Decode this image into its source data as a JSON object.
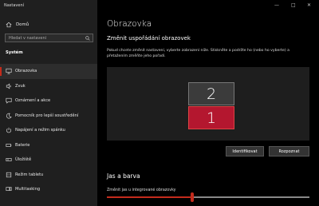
{
  "window": {
    "title": "Nastavení"
  },
  "sidebar": {
    "home_label": "Domů",
    "search_placeholder": "Hledat v nastavení",
    "section_label": "Systém",
    "items": [
      {
        "label": "Obrazovka",
        "icon": "monitor-icon",
        "active": true
      },
      {
        "label": "Zvuk",
        "icon": "speaker-icon"
      },
      {
        "label": "Oznámení a akce",
        "icon": "message-icon"
      },
      {
        "label": "Pomocník pro lepší soustředění",
        "icon": "moon-icon"
      },
      {
        "label": "Napájení a režim spánku",
        "icon": "power-icon"
      },
      {
        "label": "Baterie",
        "icon": "battery-icon"
      },
      {
        "label": "Úložiště",
        "icon": "storage-icon"
      },
      {
        "label": "Režim tabletu",
        "icon": "tablet-icon"
      },
      {
        "label": "Multitasking",
        "icon": "multitasking-icon"
      }
    ]
  },
  "main": {
    "title": "Obrazovka",
    "arrangement_heading": "Změnit uspořádání obrazovek",
    "arrangement_desc": "Pokud chcete změnit nastavení, vyberte zobrazení níže. Stiskněte a podržte ho (nebo ho vyberte) a přetažením změňte jeho pořadí.",
    "monitors": {
      "top": "2",
      "bottom": "1"
    },
    "identify_button": "Identifikovat",
    "detect_button": "Rozpoznat",
    "brightness_heading": "Jas a barva",
    "brightness_label": "Změnit jas u integrované obrazovky",
    "brightness_value": 0.42
  },
  "colors": {
    "accent": "#c42b1c",
    "sidebar_bg": "#1f1f1f",
    "main_bg": "#000000"
  }
}
